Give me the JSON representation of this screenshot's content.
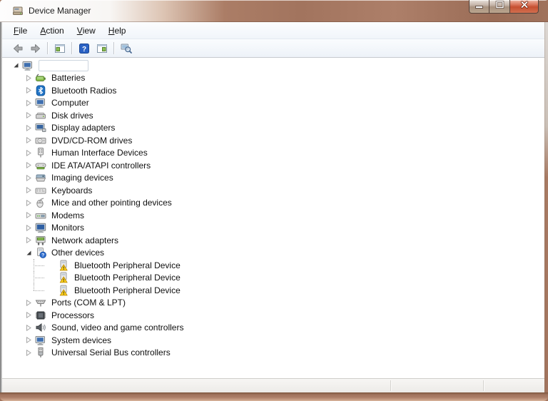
{
  "window": {
    "title": "Device Manager",
    "icon": "device-manager-icon",
    "controls": [
      {
        "name": "minimize",
        "icon": "minimize-icon"
      },
      {
        "name": "maximize",
        "icon": "maximize-icon"
      },
      {
        "name": "close",
        "icon": "close-icon"
      }
    ]
  },
  "menu": {
    "items": [
      {
        "label": "File",
        "underline": 0
      },
      {
        "label": "Action",
        "underline": 0
      },
      {
        "label": "View",
        "underline": 0
      },
      {
        "label": "Help",
        "underline": 0
      }
    ]
  },
  "toolbar": {
    "buttons": [
      {
        "name": "back",
        "icon": "back-arrow-icon"
      },
      {
        "name": "forward",
        "icon": "forward-arrow-icon"
      },
      {
        "separator": true
      },
      {
        "name": "show-console-tree",
        "icon": "console-tree-icon"
      },
      {
        "separator": true
      },
      {
        "name": "help",
        "icon": "help-icon"
      },
      {
        "name": "show-action-pane",
        "icon": "action-pane-icon"
      },
      {
        "separator": true
      },
      {
        "name": "scan-for-hardware-changes",
        "icon": "scan-hardware-icon"
      }
    ]
  },
  "tree": {
    "root": {
      "label": "",
      "icon": "computer-icon",
      "state": "expanded"
    },
    "items": [
      {
        "label": "Batteries",
        "icon": "battery-icon",
        "level": 1,
        "state": "collapsed"
      },
      {
        "label": "Bluetooth Radios",
        "icon": "bluetooth-icon",
        "level": 1,
        "state": "collapsed"
      },
      {
        "label": "Computer",
        "icon": "computer-icon",
        "level": 1,
        "state": "collapsed"
      },
      {
        "label": "Disk drives",
        "icon": "disk-drive-icon",
        "level": 1,
        "state": "collapsed"
      },
      {
        "label": "Display adapters",
        "icon": "display-adapter-icon",
        "level": 1,
        "state": "collapsed"
      },
      {
        "label": "DVD/CD-ROM drives",
        "icon": "dvd-drive-icon",
        "level": 1,
        "state": "collapsed"
      },
      {
        "label": "Human Interface Devices",
        "icon": "hid-icon",
        "level": 1,
        "state": "collapsed"
      },
      {
        "label": "IDE ATA/ATAPI controllers",
        "icon": "ide-controller-icon",
        "level": 1,
        "state": "collapsed"
      },
      {
        "label": "Imaging devices",
        "icon": "imaging-device-icon",
        "level": 1,
        "state": "collapsed"
      },
      {
        "label": "Keyboards",
        "icon": "keyboard-icon",
        "level": 1,
        "state": "collapsed"
      },
      {
        "label": "Mice and other pointing devices",
        "icon": "mouse-icon",
        "level": 1,
        "state": "collapsed"
      },
      {
        "label": "Modems",
        "icon": "modem-icon",
        "level": 1,
        "state": "collapsed"
      },
      {
        "label": "Monitors",
        "icon": "monitor-icon",
        "level": 1,
        "state": "collapsed"
      },
      {
        "label": "Network adapters",
        "icon": "network-adapter-icon",
        "level": 1,
        "state": "collapsed"
      },
      {
        "label": "Other devices",
        "icon": "unknown-device-icon",
        "level": 1,
        "state": "expanded"
      },
      {
        "label": "Bluetooth Peripheral Device",
        "icon": "warning-device-icon",
        "level": 2,
        "state": "leaf"
      },
      {
        "label": "Bluetooth Peripheral Device",
        "icon": "warning-device-icon",
        "level": 2,
        "state": "leaf"
      },
      {
        "label": "Bluetooth Peripheral Device",
        "icon": "warning-device-icon",
        "level": 2,
        "state": "leaf",
        "last": true
      },
      {
        "label": "Ports (COM & LPT)",
        "icon": "port-icon",
        "level": 1,
        "state": "collapsed"
      },
      {
        "label": "Processors",
        "icon": "processor-icon",
        "level": 1,
        "state": "collapsed"
      },
      {
        "label": "Sound, video and game controllers",
        "icon": "sound-icon",
        "level": 1,
        "state": "collapsed"
      },
      {
        "label": "System devices",
        "icon": "computer-icon",
        "level": 1,
        "state": "collapsed"
      },
      {
        "label": "Universal Serial Bus controllers",
        "icon": "usb-icon",
        "level": 1,
        "state": "collapsed"
      }
    ]
  },
  "statusbar": {
    "panes": [
      "",
      "",
      ""
    ]
  },
  "colors": {
    "titlebar_glass": "#a2745e",
    "close_button_red": "#c64f31",
    "help_blue": "#2b62c4",
    "warning_yellow": "#fdd017",
    "bluetooth_blue": "#2173c5",
    "battery_green": "#8cc152",
    "tree_text": "#101010",
    "toolbar_bg": "#edf2f8",
    "content_bg": "#ffffff"
  }
}
